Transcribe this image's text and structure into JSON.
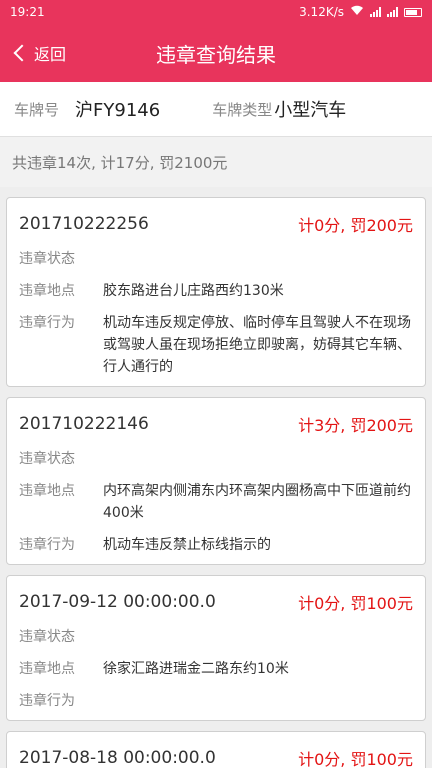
{
  "status": {
    "time": "19:21",
    "speed": "3.12K/s"
  },
  "header": {
    "back_label": "返回",
    "title": "违章查询结果"
  },
  "plate": {
    "plate_label": "车牌号",
    "plate_value": "沪FY9146",
    "type_label": "车牌类型",
    "type_value": "小型汽车"
  },
  "summary": "共违章14次, 计17分, 罚2100元",
  "labels": {
    "state": "违章状态",
    "location": "违章地点",
    "behavior": "违章行为"
  },
  "records": [
    {
      "date": "201710222256",
      "penalty": "计0分, 罚200元",
      "state": "",
      "location": "胶东路进台儿庄路西约130米",
      "behavior": "机动车违反规定停放、临时停车且驾驶人不在现场或驾驶人虽在现场拒绝立即驶离，妨碍其它车辆、行人通行的"
    },
    {
      "date": "201710222146",
      "penalty": "计3分, 罚200元",
      "state": "",
      "location": "内环高架内侧浦东内环高架内圈杨高中下匝道前约400米",
      "behavior": "机动车违反禁止标线指示的"
    },
    {
      "date": "2017-09-12 00:00:00.0",
      "penalty": "计0分, 罚100元",
      "state": "",
      "location": "徐家汇路进瑞金二路东约10米",
      "behavior": ""
    },
    {
      "date": "2017-08-18 00:00:00.0",
      "penalty": "计0分, 罚100元",
      "state": "",
      "location": "",
      "behavior": ""
    }
  ]
}
